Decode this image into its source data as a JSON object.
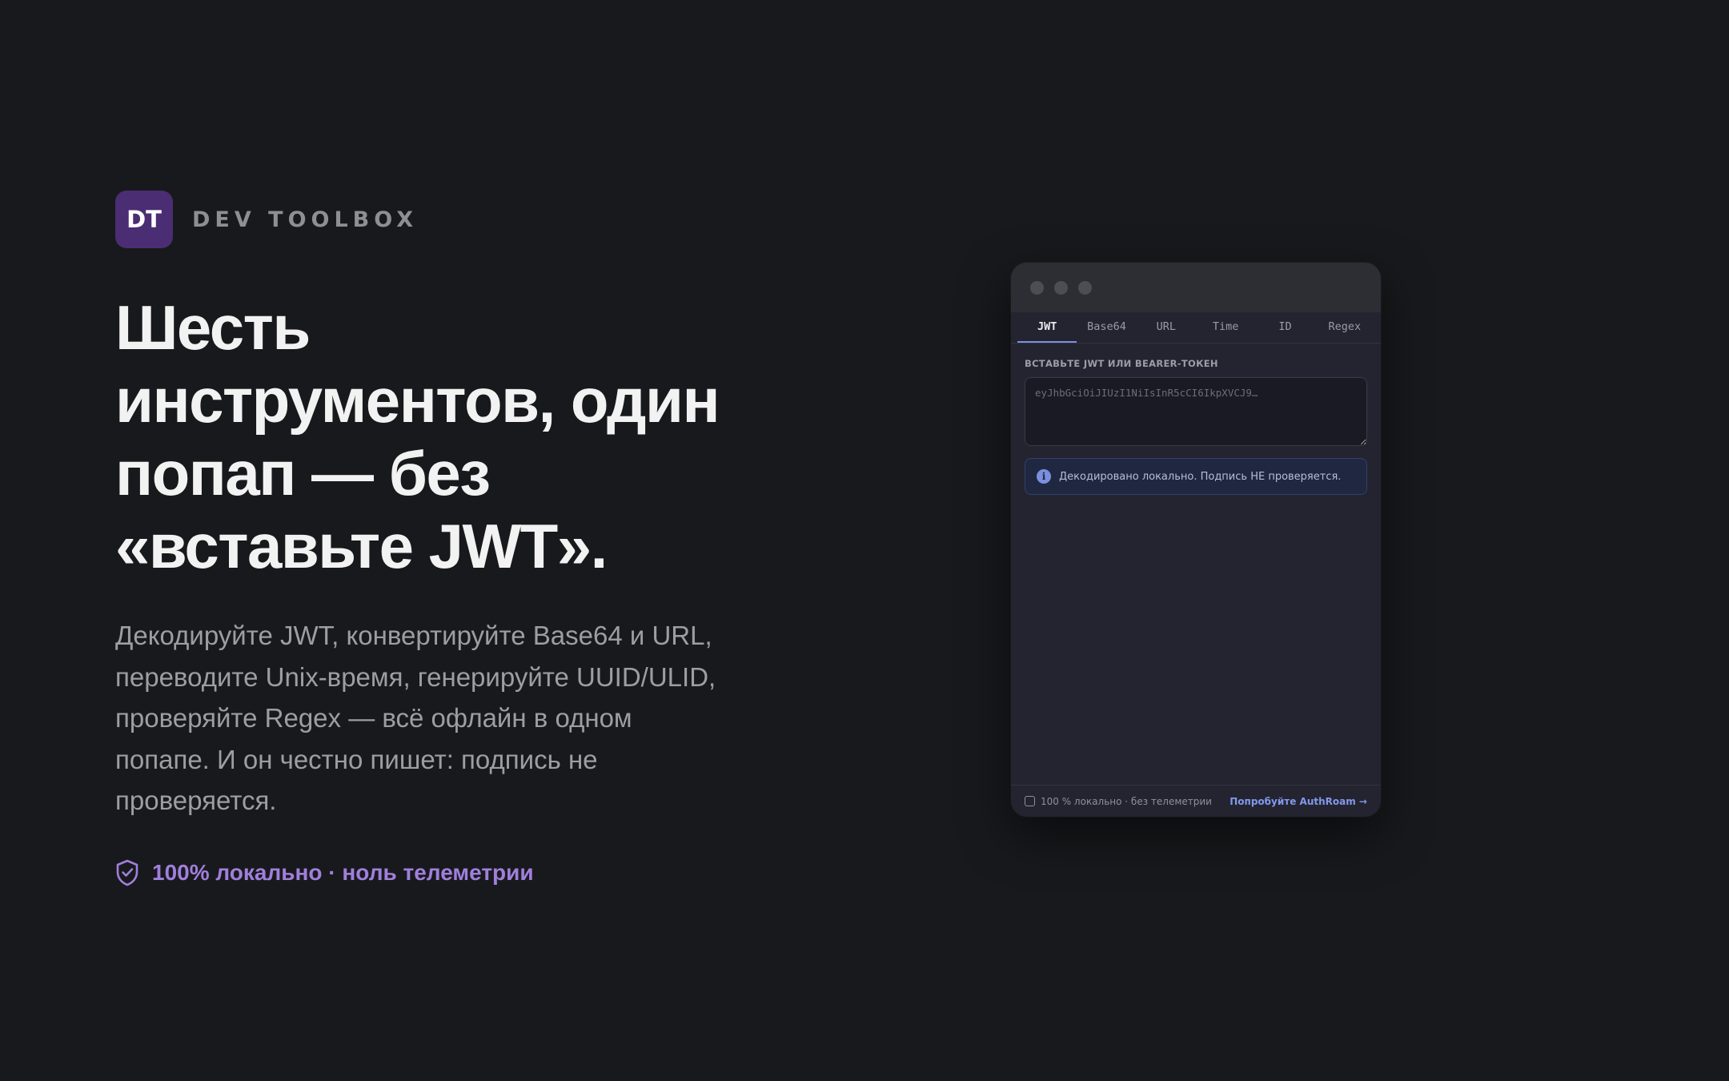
{
  "brand": {
    "logo_text": "DT",
    "name": "DEV TOOLBOX",
    "logo_color": "#4b2d73"
  },
  "hero": {
    "headline": "Шесть инструментов, один попап — без «вставьте JWT».",
    "subtitle": "Декодируйте JWT, конвертируйте Base64 и URL, переводите Unix-время, генерируйте UUID/ULID, проверяйте Regex — всё офлайн в одном попапе. И он честно пишет: подпись не проверяется.",
    "privacy_icon": "shield-check-icon",
    "privacy_text": "100% локально · ноль телеметрии",
    "accent_color": "#a07fdc"
  },
  "popup": {
    "tabs": [
      {
        "label": "JWT",
        "active": true
      },
      {
        "label": "Base64",
        "active": false
      },
      {
        "label": "URL",
        "active": false
      },
      {
        "label": "Time",
        "active": false
      },
      {
        "label": "ID",
        "active": false
      },
      {
        "label": "Regex",
        "active": false
      }
    ],
    "field_label": "ВСТАВЬТЕ JWT ИЛИ BEARER-ТОКЕН",
    "input_placeholder": "eyJhbGciOiJIUzI1NiIsInR5cCI6IkpXVCJ9…",
    "notice_icon": "info-icon",
    "notice_text": "Декодировано локально. Подпись НЕ проверяется.",
    "footer": {
      "local_text": "100 % локально · без телеметрии",
      "cta_text": "Попробуйте AuthRoam →"
    },
    "tab_accent_color": "#7b8fe0"
  }
}
